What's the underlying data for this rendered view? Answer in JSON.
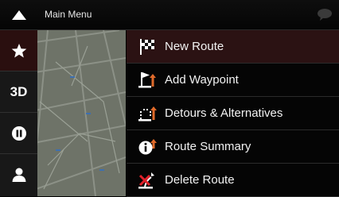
{
  "header": {
    "title": "Main Menu"
  },
  "side_buttons": [
    {
      "name": "favorites",
      "icon": "star-icon"
    },
    {
      "name": "view-mode",
      "label": "3D"
    },
    {
      "name": "pause",
      "icon": "pause-icon"
    },
    {
      "name": "user",
      "icon": "user-icon"
    }
  ],
  "menu": {
    "items": [
      {
        "label": "New Route",
        "icon": "checkered-flag-icon",
        "selected": true
      },
      {
        "label": "Add Waypoint",
        "icon": "add-waypoint-flag-icon"
      },
      {
        "label": "Detours & Alternatives",
        "icon": "detour-icon"
      },
      {
        "label": "Route Summary",
        "icon": "info-icon"
      },
      {
        "label": "Delete Route",
        "icon": "delete-route-icon"
      }
    ]
  },
  "colors": {
    "accent": "#e06a2a",
    "selected_bg": "#2b1213",
    "map": "#6f7469"
  }
}
